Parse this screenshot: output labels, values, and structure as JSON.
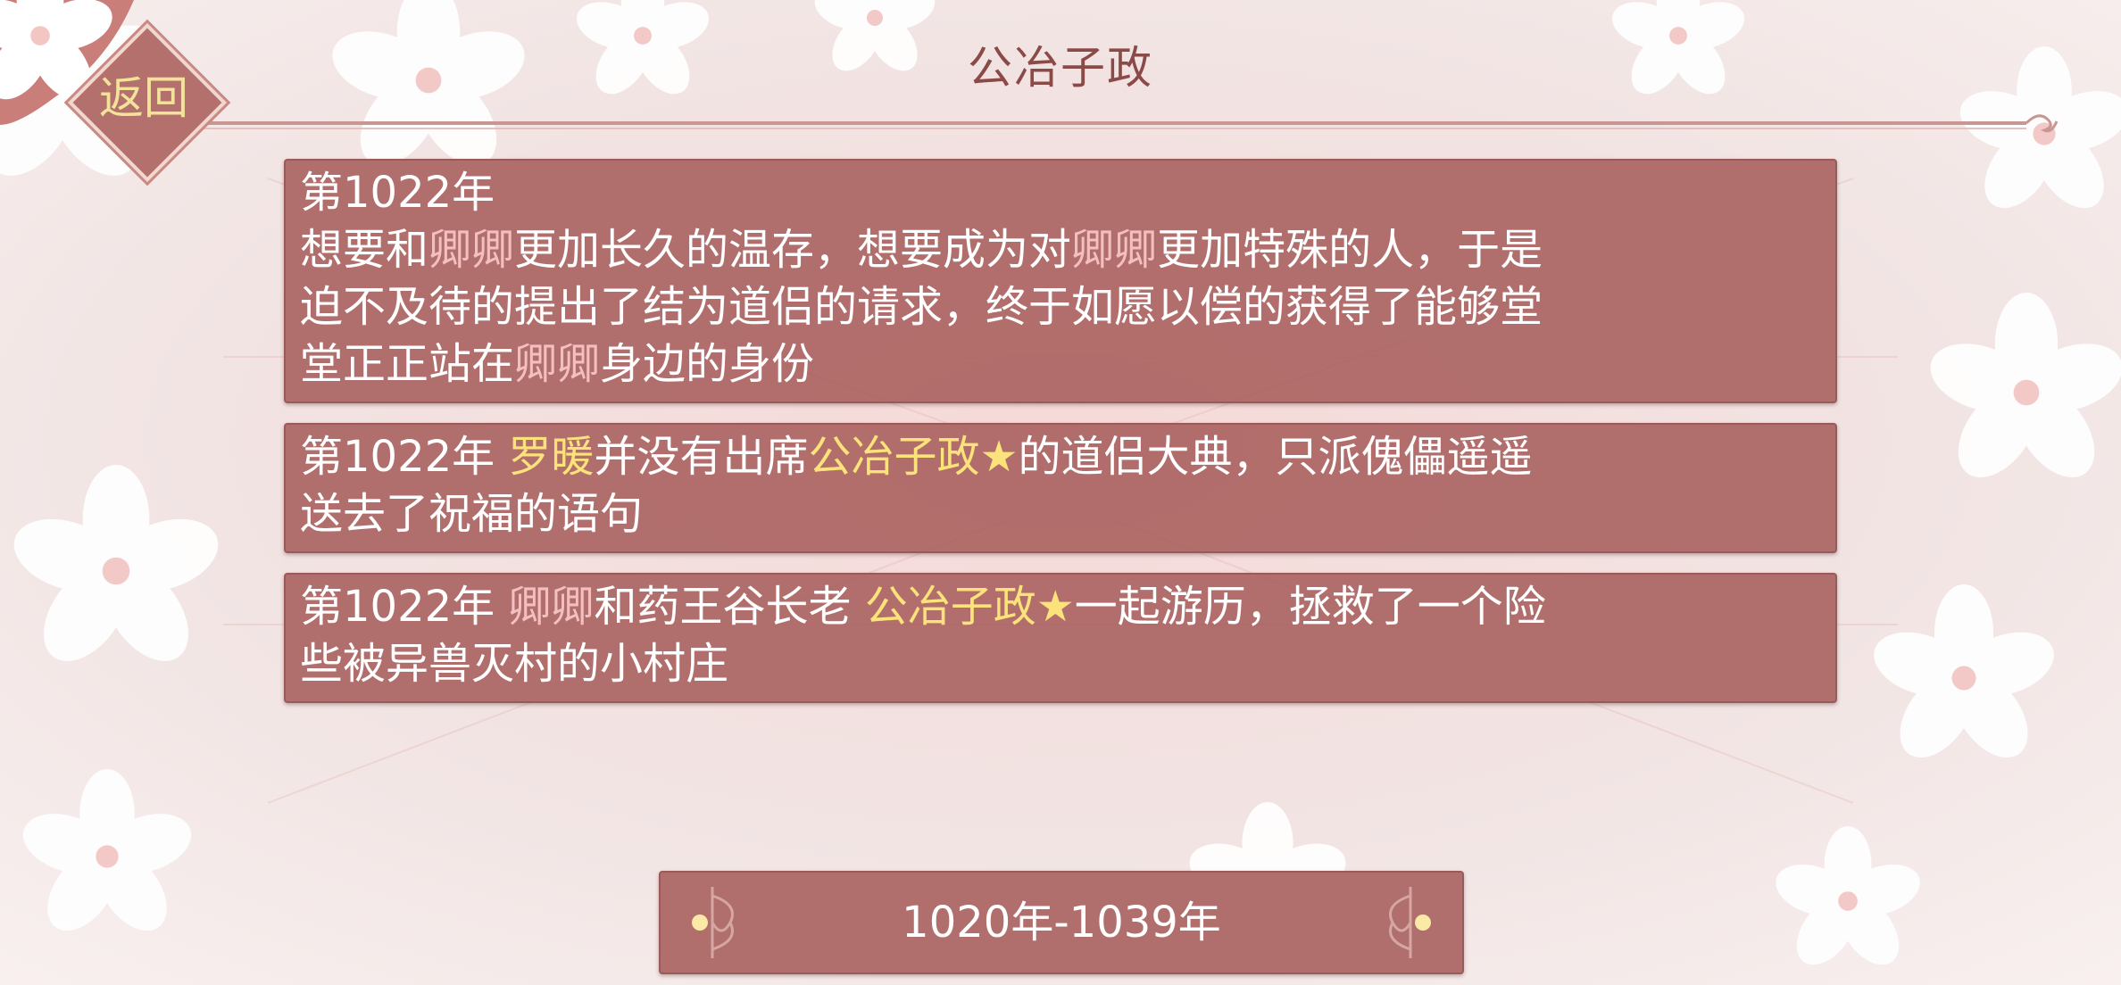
{
  "header": {
    "title": "公冶子政",
    "back_label": "返回"
  },
  "events": [
    {
      "lines": [
        [
          {
            "text": "第1022年",
            "color": "normal"
          }
        ],
        [
          {
            "text": "想要和",
            "color": "normal"
          },
          {
            "text": "卿卿",
            "color": "pink"
          },
          {
            "text": "更加长久的温存，想要成为对",
            "color": "normal"
          },
          {
            "text": "卿卿",
            "color": "pink"
          },
          {
            "text": "更加特殊的人，于是",
            "color": "normal"
          }
        ],
        [
          {
            "text": "迫不及待的提出了结为道侣的请求，终于如愿以偿的获得了能够堂",
            "color": "normal"
          }
        ],
        [
          {
            "text": "堂正正站在",
            "color": "normal"
          },
          {
            "text": "卿卿",
            "color": "pink"
          },
          {
            "text": "身边的身份",
            "color": "normal"
          }
        ]
      ]
    },
    {
      "lines": [
        [
          {
            "text": "第1022年 ",
            "color": "normal"
          },
          {
            "text": "罗暖",
            "color": "yellow"
          },
          {
            "text": "并没有出席",
            "color": "normal"
          },
          {
            "text": "公冶子政★",
            "color": "yellow"
          },
          {
            "text": "的道侣大典，只派傀儡遥遥",
            "color": "normal"
          }
        ],
        [
          {
            "text": "送去了祝福的语句",
            "color": "normal"
          }
        ]
      ]
    },
    {
      "lines": [
        [
          {
            "text": "第1022年 ",
            "color": "normal"
          },
          {
            "text": "卿卿",
            "color": "pink"
          },
          {
            "text": "和药王谷长老 ",
            "color": "normal"
          },
          {
            "text": "公冶子政★",
            "color": "yellow"
          },
          {
            "text": "一起游历，拯救了一个险",
            "color": "normal"
          }
        ],
        [
          {
            "text": "些被异兽灭村的小村庄",
            "color": "normal"
          }
        ]
      ]
    }
  ],
  "era": {
    "label": "1020年-1039年"
  },
  "colors": {
    "normal": "#ffffff",
    "pink": "#f4bfc0",
    "yellow": "#fbe27a",
    "card_bg": "#aa6462",
    "title": "#8a4a48",
    "back_label": "#f3e39a"
  },
  "icons": {
    "back": "diamond-badge",
    "era_left": "scroll-ornament-left",
    "era_right": "scroll-ornament-right",
    "background": "plum-blossom-pattern"
  }
}
